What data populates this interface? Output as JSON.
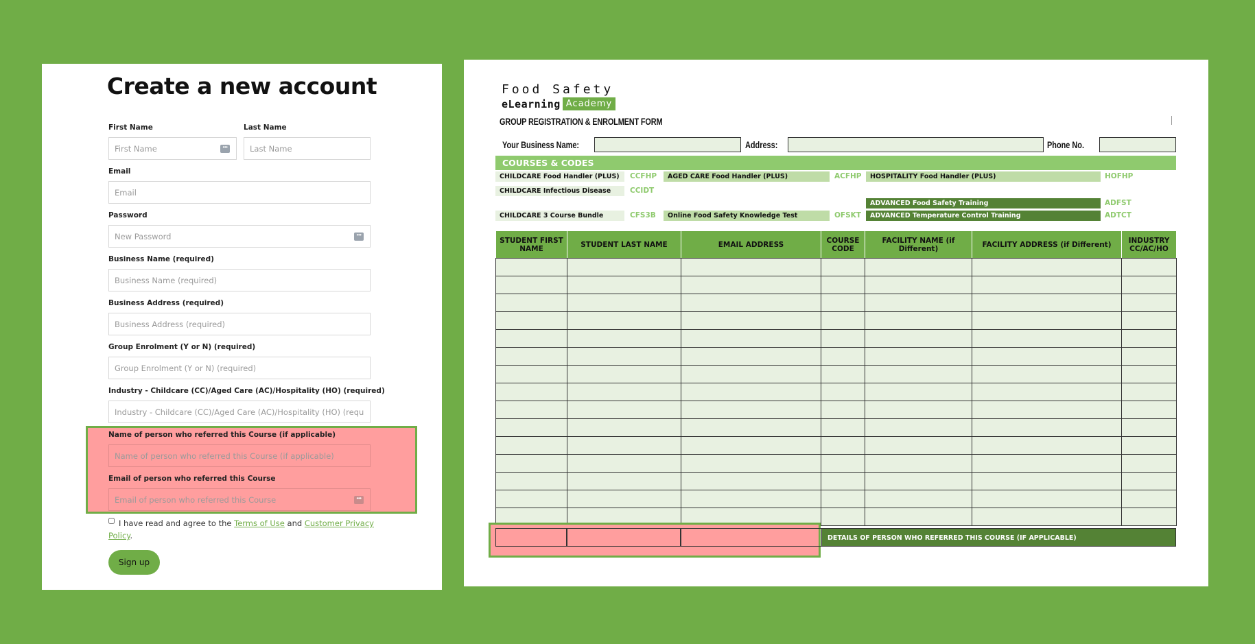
{
  "signup": {
    "title": "Create a new account",
    "first_name": {
      "label": "First Name",
      "placeholder": "First Name"
    },
    "last_name": {
      "label": "Last Name",
      "placeholder": "Last Name"
    },
    "email": {
      "label": "Email",
      "placeholder": "Email"
    },
    "password": {
      "label": "Password",
      "placeholder": "New Password"
    },
    "business_name": {
      "label": "Business Name (required)",
      "placeholder": "Business Name (required)"
    },
    "business_address": {
      "label": "Business Address (required)",
      "placeholder": "Business Address (required)"
    },
    "group_enrolment": {
      "label": "Group Enrolment (Y or N) (required)",
      "placeholder": "Group Enrolment (Y or N) (required)"
    },
    "industry": {
      "label": "Industry - Childcare (CC)/Aged Care (AC)/Hospitality (HO) (required)",
      "placeholder": "Industry - Childcare (CC)/Aged Care (AC)/Hospitality (HO) (required)"
    },
    "referrer_name": {
      "label": "Name of person who referred this Course (if applicable)",
      "placeholder": "Name of person who referred this Course (if applicable)"
    },
    "referrer_email": {
      "label": "Email of person who referred this Course",
      "placeholder": "Email of person who referred this Course"
    },
    "agree": {
      "prefix": "I have read and agree to the",
      "terms_link": "Terms of Use",
      "and": "and",
      "privacy_link": "Customer Privacy Policy",
      "suffix": "."
    },
    "signup_button": "Sign up",
    "referral_highlight_color": "#ff9e9e"
  },
  "paper_form": {
    "logo": {
      "line1": "Food Safety",
      "elearning": "eLearning",
      "academy": "Academy"
    },
    "title": "GROUP REGISTRATION & ENROLMENT FORM",
    "business_name_label": "Your Business Name:",
    "address_label": "Address:",
    "phone_label": "Phone No.",
    "courses_header": "COURSES & CODES",
    "courses": {
      "childcare_fh": {
        "name": "CHILDCARE Food Handler (PLUS)",
        "code": "CCFHP"
      },
      "childcare_id": {
        "name": "CHILDCARE Infectious Disease",
        "code": "CCIDT"
      },
      "childcare_3": {
        "name": "CHILDCARE 3 Course Bundle",
        "code": "CFS3B"
      },
      "aged_fh": {
        "name": "AGED CARE Food Handler (PLUS)",
        "code": "ACFHP"
      },
      "online_test": {
        "name": "Online Food Safety Knowledge Test",
        "code": "OFSKT"
      },
      "hosp_fh": {
        "name": "HOSPITALITY Food Handler (PLUS)",
        "code": "HOFHP"
      },
      "adv_fst": {
        "name": "ADVANCED Food Safety Training",
        "code": "ADFST"
      },
      "adv_tct": {
        "name": "ADVANCED Temperature Control Training",
        "code": "ADTCT"
      }
    },
    "columns": {
      "first_name": "STUDENT FIRST NAME",
      "last_name": "STUDENT LAST NAME",
      "email": "EMAIL ADDRESS",
      "course_code": "COURSE CODE",
      "facility_name": "FACILITY NAME (if Different)",
      "facility_address": "FACILITY ADDRESS (if Different)",
      "industry": "INDUSTRY CC/AC/HO"
    },
    "referral_banner": "DETAILS OF PERSON WHO REFERRED THIS COURSE (IF APPLICABLE)",
    "colors": {
      "green": "#70ad47",
      "dark_green": "#548235",
      "light_green": "#e8f1e1",
      "highlight": "#ff9e9e"
    }
  }
}
